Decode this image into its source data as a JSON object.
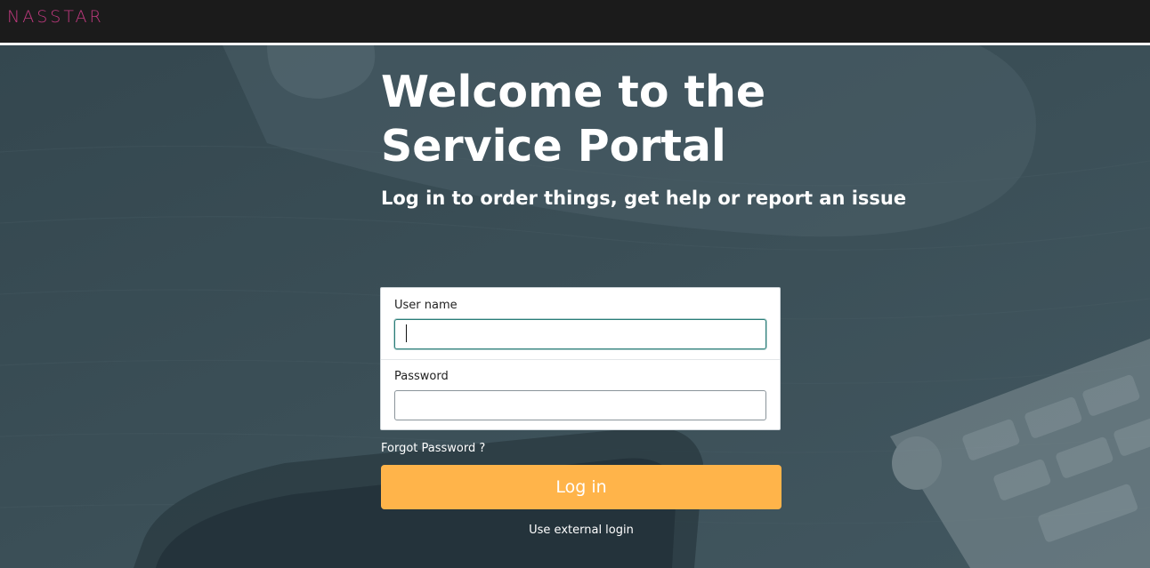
{
  "header": {
    "logo_text": "NASSTAR",
    "logo_color": "#c0397f",
    "background_color": "#1b1b1b"
  },
  "hero": {
    "title": "Welcome to the Service Portal",
    "subtitle": "Log in to order things, get help or report an issue",
    "background_color": "#3b4e56"
  },
  "login": {
    "username_label": "User name",
    "username_value": "",
    "password_label": "Password",
    "password_value": "",
    "forgot_password": "Forgot Password ?",
    "submit_label": "Log in",
    "external_login": "Use external login",
    "button_color": "#ffb44a"
  }
}
